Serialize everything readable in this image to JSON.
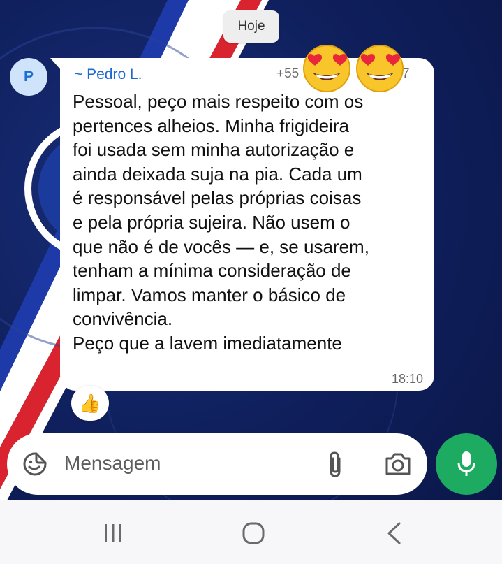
{
  "date_chip": "Hoje",
  "colors": {
    "accent_sender": "#1f6ad1",
    "bubble_bg": "#ffffff",
    "mic_button": "#1daa61",
    "chat_background": "#0f1f5c"
  },
  "message": {
    "avatar_initial": "P",
    "sender": "~ Pedro L.",
    "phone_prefix": "+55",
    "phone_suffix": "7",
    "text": "Pessoal, peço mais respeito com os\npertences alheios. Minha frigideira\nfoi usada sem minha autorização e\nainda deixada suja na pia. Cada um\né responsável pelas próprias coisas\ne pela própria sujeira. Não usem o\nque não é de vocês — e, se usarem,\ntenham a mínima consideração de\nlimpar. Vamos manter o básico de\nconvivência.\nPeço que a lavem imediatamente",
    "time": "18:10",
    "reaction": "👍",
    "stickers": [
      "heart-eyes-emoji-icon",
      "heart-eyes-emoji-icon"
    ]
  },
  "composer": {
    "placeholder": "Mensagem",
    "icons": [
      "sticker-emoji-icon",
      "paperclip-icon",
      "camera-icon",
      "microphone-icon"
    ]
  },
  "navbar": {
    "icons": [
      "recent-apps-icon",
      "home-icon",
      "back-icon"
    ]
  }
}
